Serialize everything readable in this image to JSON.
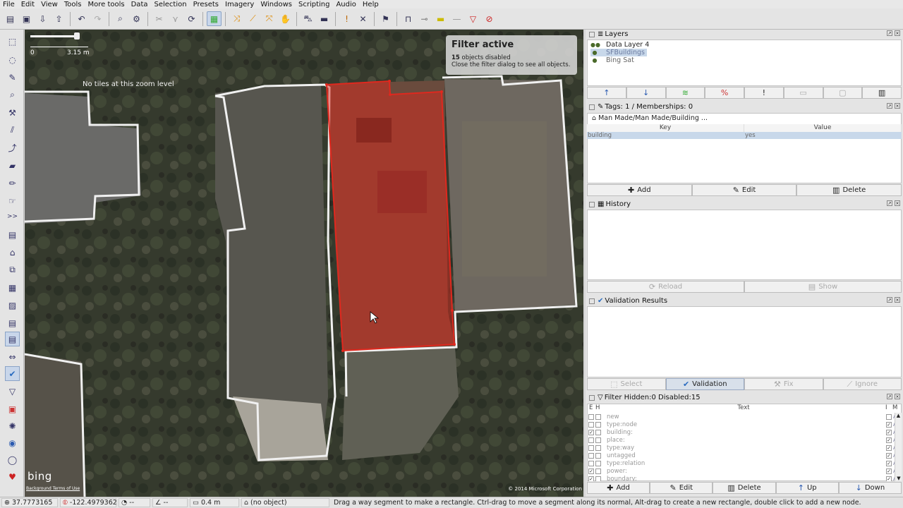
{
  "menu": [
    "File",
    "Edit",
    "View",
    "Tools",
    "More tools",
    "Data",
    "Selection",
    "Presets",
    "Imagery",
    "Windows",
    "Scripting",
    "Audio",
    "Help"
  ],
  "map": {
    "scale_start": "0",
    "scale_end": "3.15 m",
    "no_tiles": "No tiles at this zoom level",
    "filter_title": "Filter active",
    "filter_count": "15",
    "filter_line1_suffix": " objects disabled",
    "filter_line2": "Close the filter dialog to see all objects.",
    "bing_logo": "bing",
    "background_terms": "Background Terms of Use",
    "copyright": "© 2014 Microsoft Corporation",
    "selected_color": "#e0281e"
  },
  "layers": {
    "title": "Layers",
    "items": [
      {
        "name": "Data Layer 4"
      },
      {
        "name": "SFBuildings"
      },
      {
        "name": "Bing Sat"
      }
    ]
  },
  "tags": {
    "title": "Tags: 1 / Memberships: 0",
    "preset": "Man Made/Man Made/Building ...",
    "key_header": "Key",
    "value_header": "Value",
    "rows": [
      {
        "key": "building",
        "value": "yes"
      }
    ],
    "add": "Add",
    "edit": "Edit",
    "delete": "Delete"
  },
  "history": {
    "title": "History",
    "reload": "Reload",
    "show": "Show"
  },
  "validation": {
    "title": "Validation Results",
    "select": "Select",
    "validation": "Validation",
    "fix": "Fix",
    "ignore": "Ignore"
  },
  "filter": {
    "title": "Filter Hidden:0 Disabled:15",
    "col_e": "E",
    "col_h": "H",
    "col_text": "Text",
    "col_i": "I",
    "col_m": "M",
    "rows": [
      {
        "e": false,
        "text": "new",
        "i": false
      },
      {
        "e": false,
        "text": " type:node",
        "i": true
      },
      {
        "e": true,
        "text": "building:",
        "i": true
      },
      {
        "e": false,
        "text": "place:",
        "i": true
      },
      {
        "e": false,
        "text": " type:way",
        "i": true
      },
      {
        "e": false,
        "text": " untagged",
        "i": true
      },
      {
        "e": false,
        "text": " type:relation",
        "i": true
      },
      {
        "e": true,
        "text": "power:",
        "i": true
      },
      {
        "e": true,
        "text": "boundary:",
        "i": true
      }
    ],
    "add": "Add",
    "edit": "Edit",
    "delete": "Delete",
    "up": "Up",
    "down": "Down"
  },
  "status": {
    "lat": "37.7773165",
    "lon": "-122.4979362",
    "heading": "--",
    "angle": "--",
    "length": "0.4 m",
    "object": "(no object)",
    "message": "Drag a way segment to make a rectangle. Ctrl-drag to move a segment along its normal, Alt-drag to create a new rectangle, double click to add a new node."
  }
}
